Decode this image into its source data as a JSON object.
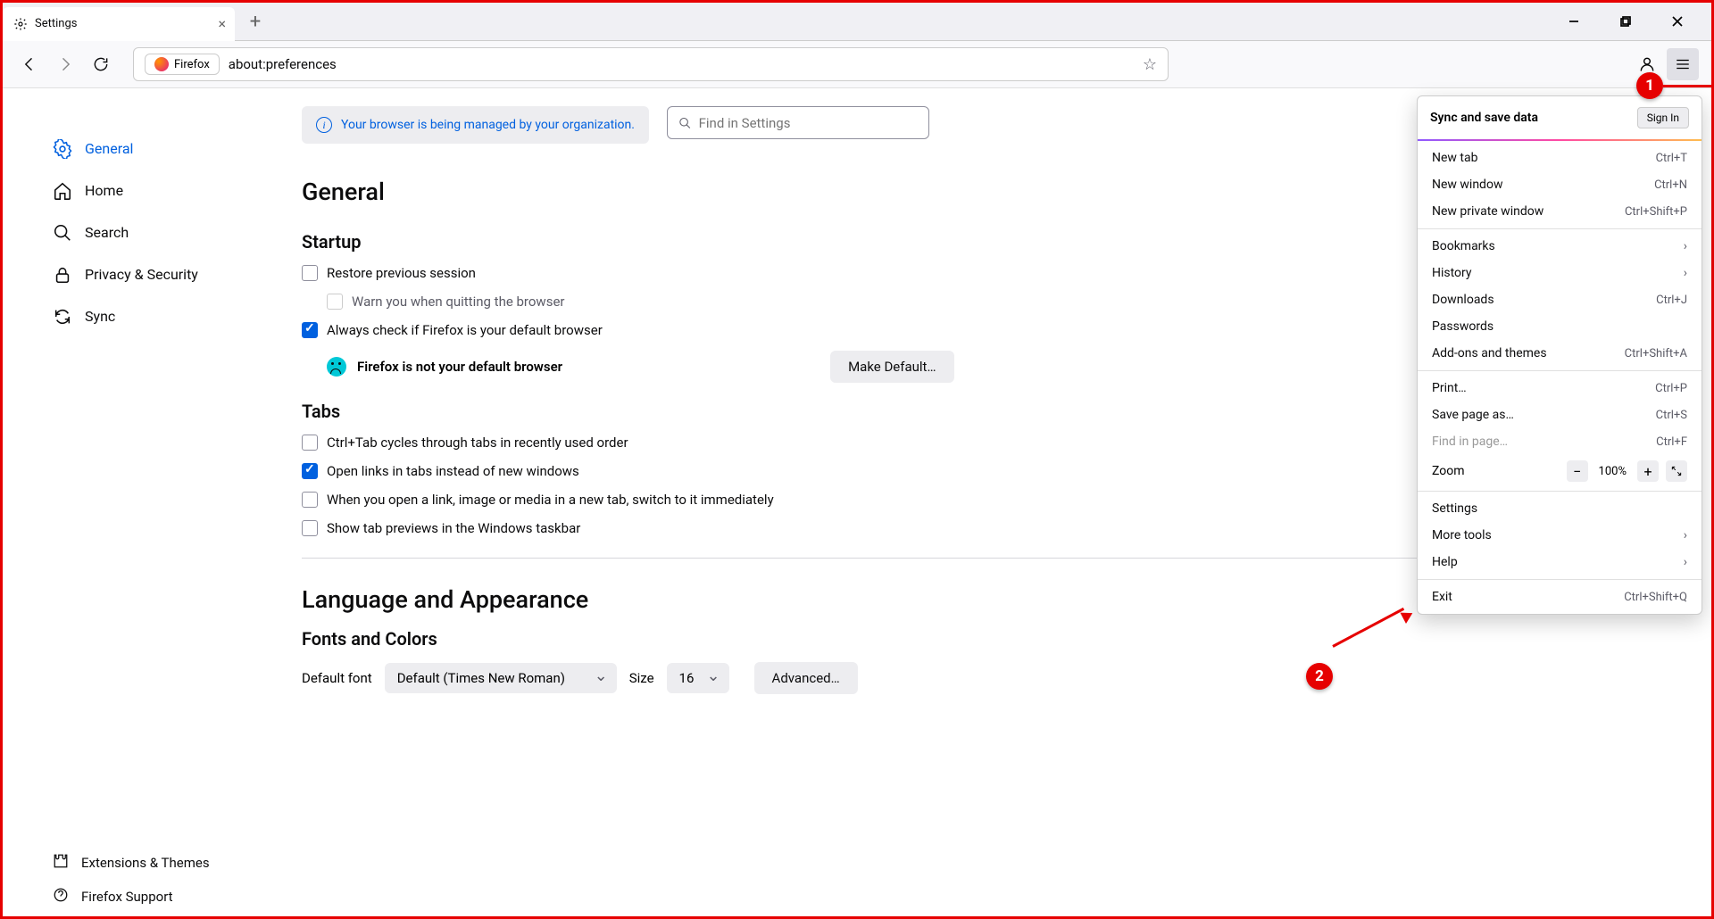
{
  "tab": {
    "title": "Settings"
  },
  "url": {
    "badge": "Firefox",
    "path": "about:preferences"
  },
  "notice": "Your browser is being managed by your organization.",
  "search_placeholder": "Find in Settings",
  "sidebar": {
    "items": [
      {
        "label": "General"
      },
      {
        "label": "Home"
      },
      {
        "label": "Search"
      },
      {
        "label": "Privacy & Security"
      },
      {
        "label": "Sync"
      }
    ],
    "bottom": [
      {
        "label": "Extensions & Themes"
      },
      {
        "label": "Firefox Support"
      }
    ]
  },
  "headings": {
    "general": "General",
    "startup": "Startup",
    "tabs": "Tabs",
    "language": "Language and Appearance",
    "fonts": "Fonts and Colors"
  },
  "startup": {
    "restore": "Restore previous session",
    "warn": "Warn you when quitting the browser",
    "always_check": "Always check if Firefox is your default browser",
    "not_default": "Firefox is not your default browser",
    "make_default": "Make Default…"
  },
  "tabs_section": {
    "ctrl_tab": "Ctrl+Tab cycles through tabs in recently used order",
    "open_links": "Open links in tabs instead of new windows",
    "switch_immediately": "When you open a link, image or media in a new tab, switch to it immediately",
    "taskbar_preview": "Show tab previews in the Windows taskbar"
  },
  "fonts": {
    "default_label": "Default font",
    "default_value": "Default (Times New Roman)",
    "size_label": "Size",
    "size_value": "16",
    "advanced": "Advanced…"
  },
  "menu": {
    "sync": "Sync and save data",
    "signin": "Sign In",
    "new_tab": "New tab",
    "new_tab_sc": "Ctrl+T",
    "new_window": "New window",
    "new_window_sc": "Ctrl+N",
    "new_private": "New private window",
    "new_private_sc": "Ctrl+Shift+P",
    "bookmarks": "Bookmarks",
    "history": "History",
    "downloads": "Downloads",
    "downloads_sc": "Ctrl+J",
    "passwords": "Passwords",
    "addons": "Add-ons and themes",
    "addons_sc": "Ctrl+Shift+A",
    "print": "Print…",
    "print_sc": "Ctrl+P",
    "save_as": "Save page as…",
    "save_as_sc": "Ctrl+S",
    "find": "Find in page…",
    "find_sc": "Ctrl+F",
    "zoom": "Zoom",
    "zoom_val": "100%",
    "settings": "Settings",
    "more_tools": "More tools",
    "help": "Help",
    "exit": "Exit",
    "exit_sc": "Ctrl+Shift+Q"
  },
  "annotations": {
    "a1": "1",
    "a2": "2"
  }
}
